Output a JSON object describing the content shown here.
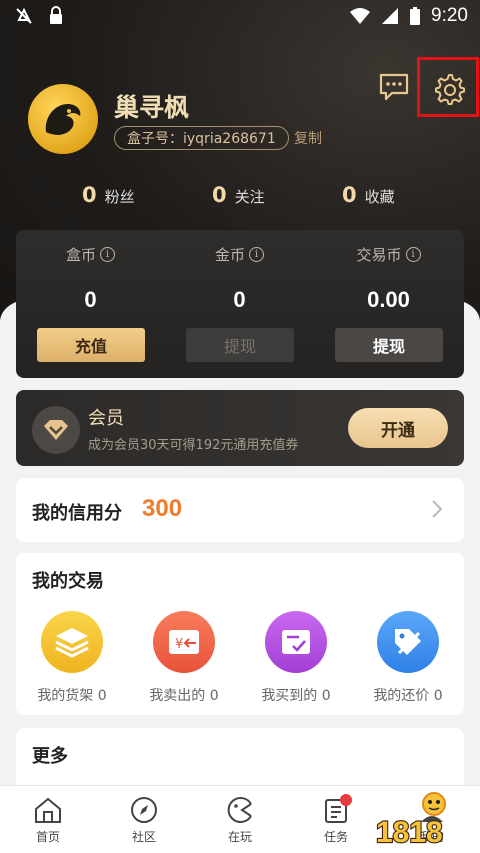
{
  "status_bar": {
    "time": "9:20"
  },
  "profile": {
    "username": "巢寻枫",
    "box_id": "盒子号：iyqria268671",
    "copy_label": "复制"
  },
  "stats": [
    {
      "value": "0",
      "label": "粉丝"
    },
    {
      "value": "0",
      "label": "关注"
    },
    {
      "value": "0",
      "label": "收藏"
    }
  ],
  "wallet": {
    "columns": [
      {
        "title": "盒币",
        "value": "0",
        "button": "充值"
      },
      {
        "title": "金币",
        "value": "0",
        "button": "提现"
      },
      {
        "title": "交易币",
        "value": "0.00",
        "button": "提现"
      }
    ]
  },
  "member": {
    "title": "会员",
    "subtitle": "成为会员30天可得192元通用充值券",
    "button": "开通"
  },
  "credit": {
    "label": "我的信用分",
    "score": "300"
  },
  "trades": {
    "title": "我的交易",
    "items": [
      {
        "label": "我的货架 0",
        "icon": "stack-icon",
        "color": "#f5c22a"
      },
      {
        "label": "我卖出的 0",
        "icon": "sell-icon",
        "color": "#f06a4c"
      },
      {
        "label": "我买到的 0",
        "icon": "bought-icon",
        "color": "#b44be0"
      },
      {
        "label": "我的还价 0",
        "icon": "price-tag-icon",
        "color": "#3d8ff0"
      }
    ]
  },
  "more": {
    "title": "更多"
  },
  "nav": [
    {
      "label": "首页",
      "icon": "home-icon"
    },
    {
      "label": "社区",
      "icon": "compass-icon"
    },
    {
      "label": "在玩",
      "icon": "game-icon"
    },
    {
      "label": "任务",
      "icon": "task-icon"
    },
    {
      "label": "我的",
      "icon": "profile-icon"
    }
  ],
  "watermark": "1818"
}
